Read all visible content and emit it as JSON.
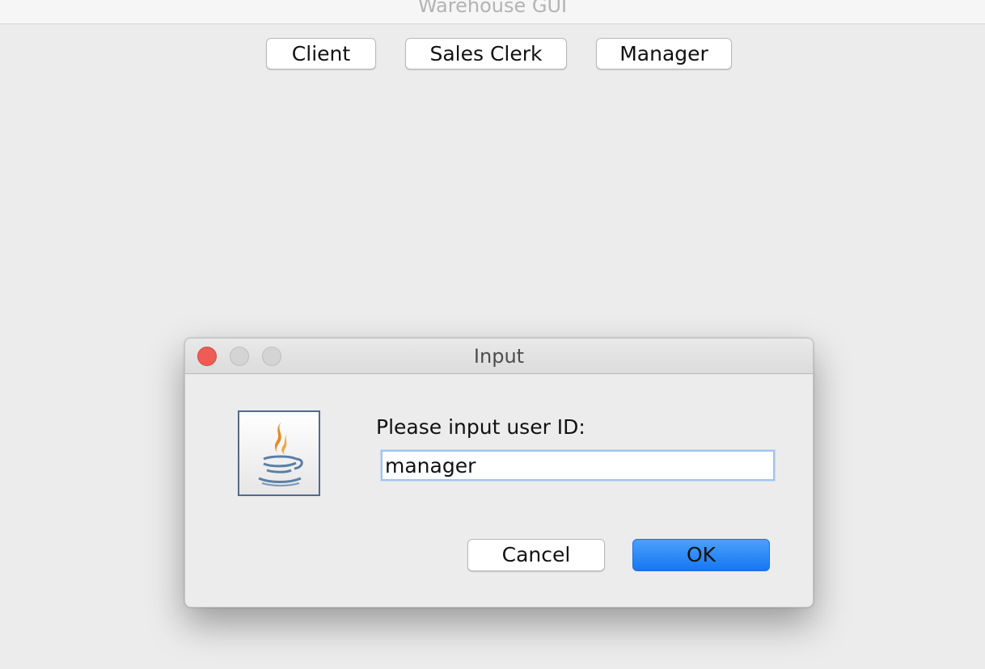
{
  "main_window": {
    "title": "Warehouse GUI",
    "buttons": {
      "client": "Client",
      "sales_clerk": "Sales Clerk",
      "manager": "Manager"
    }
  },
  "dialog": {
    "title": "Input",
    "icon": "java-coffee-cup-icon",
    "prompt": "Please input user ID:",
    "input_value": "manager",
    "cancel_label": "Cancel",
    "ok_label": "OK"
  },
  "colors": {
    "accent": "#1577f2",
    "close_button": "#ee5d55",
    "window_bg": "#ececec"
  }
}
